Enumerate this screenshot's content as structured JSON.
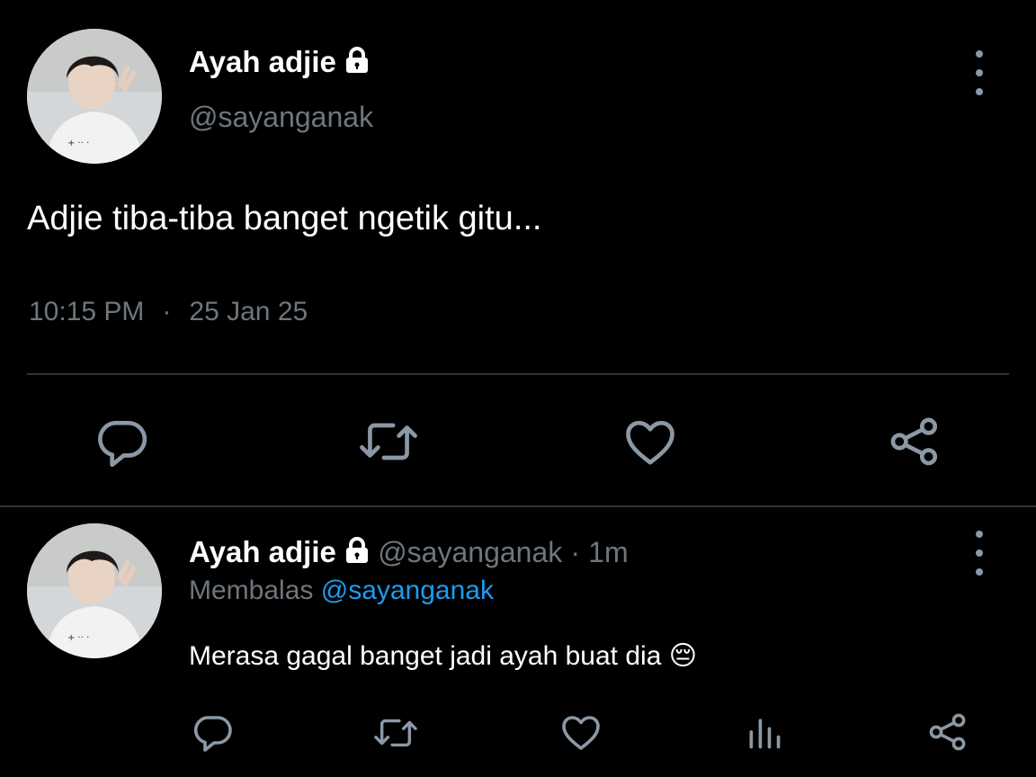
{
  "main_tweet": {
    "author_name": "Ayah adjie",
    "author_handle": "@sayanganak",
    "text": "Adjie tiba-tiba banget ngetik gitu...",
    "time": "10:15 PM",
    "separator": "·",
    "date": "25 Jan 25",
    "icons": [
      "lock-icon",
      "more-icon",
      "reply-icon",
      "retweet-icon",
      "like-icon",
      "share-icon"
    ]
  },
  "reply_tweet": {
    "author_name": "Ayah adjie",
    "author_handle": "@sayanganak",
    "separator": "·",
    "age": "1m",
    "replying_prefix": "Membalas",
    "replying_to": "@sayanganak",
    "text": "Merasa gagal banget jadi ayah buat dia",
    "emoji": "😔",
    "icons": [
      "lock-icon",
      "more-icon",
      "reply-icon",
      "retweet-icon",
      "like-icon",
      "views-icon",
      "share-icon"
    ]
  },
  "colors": {
    "background": "#000000",
    "text": "#ffffff",
    "muted": "#6e767d",
    "icon": "#8b98a5",
    "link": "#1d9bf0",
    "divider": "#2f3336"
  }
}
